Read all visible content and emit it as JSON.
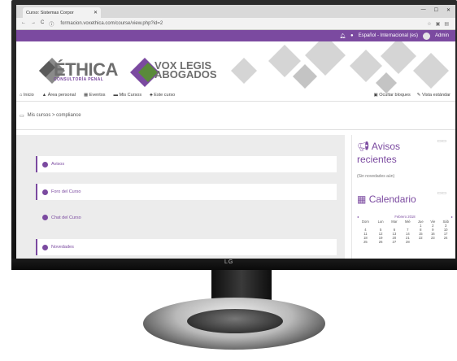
{
  "browser": {
    "tab_title": "Curso: Sistemas Corpor",
    "url": "formacion.voxethica.com/course/view.php?id=2",
    "window_controls": [
      "—",
      "☐",
      "✕"
    ]
  },
  "topbar": {
    "language": "Español - Internacional (es)",
    "user": "Admin"
  },
  "brand": {
    "name_line1": "ÉTHICA",
    "name_sub": "CONSULTORÍA PENAL",
    "partner_line1": "VOX LEGIS",
    "partner_line2": "ABOGADOS",
    "colors": {
      "purple": "#7b4aa0",
      "green": "#5a8a3a",
      "grey": "#6e6e6e"
    }
  },
  "menu": {
    "items": [
      "Inicio",
      "Área personal",
      "Eventos",
      "Mis Cursos",
      "Este curso"
    ],
    "right": [
      "Ocultar bloques",
      "Vista estándar"
    ]
  },
  "breadcrumb": "Mis cursos  >  compliance",
  "sections": [
    {
      "label": "Avisos"
    },
    {
      "label": "Foro del Curso"
    },
    {
      "label": "Chat del Curso"
    },
    {
      "label": "Novedades"
    }
  ],
  "sidebar": {
    "avisos_title": "Avisos recientes",
    "avisos_note": "(Sin novedades aún)",
    "calendar_title": "Calendario",
    "calendar_month": "Febrero 2018",
    "weekdays": [
      "Dom",
      "Lun",
      "Mar",
      "Mié",
      "Jue",
      "Vie",
      "Sáb"
    ],
    "weeks": [
      [
        "",
        "",
        "",
        "",
        "1",
        "2",
        "3"
      ],
      [
        "4",
        "5",
        "6",
        "7",
        "8",
        "9",
        "10"
      ],
      [
        "11",
        "12",
        "13",
        "14",
        "15",
        "16",
        "17"
      ],
      [
        "18",
        "19",
        "20",
        "21",
        "22",
        "23",
        "24"
      ],
      [
        "25",
        "26",
        "27",
        "28",
        "",
        "",
        ""
      ]
    ]
  },
  "monitor": {
    "logo": "LG"
  }
}
